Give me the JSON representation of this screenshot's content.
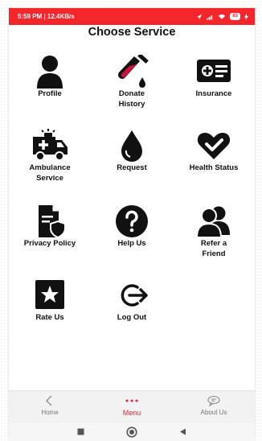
{
  "status_bar": {
    "time": "5:59 PM | 12.4KB/s",
    "battery": "83"
  },
  "header": {
    "title": "Choose Service"
  },
  "services": [
    {
      "label": "Profile",
      "icon": "person-icon"
    },
    {
      "label": "Donate\nHistory",
      "icon": "test-tube-icon"
    },
    {
      "label": "Insurance",
      "icon": "insurance-card-icon"
    },
    {
      "label": "Ambulance\nService",
      "icon": "ambulance-icon"
    },
    {
      "label": "Request",
      "icon": "blood-drop-icon"
    },
    {
      "label": "Health Status",
      "icon": "heart-check-icon"
    },
    {
      "label": "Privacy Policy",
      "icon": "shield-document-icon"
    },
    {
      "label": "Help Us",
      "icon": "question-icon"
    },
    {
      "label": "Refer a\nFriend",
      "icon": "people-icon"
    },
    {
      "label": "Rate Us",
      "icon": "star-icon"
    },
    {
      "label": "Log Out",
      "icon": "logout-icon"
    }
  ],
  "bottom_nav": {
    "items": [
      {
        "label": "Home",
        "icon": "back-chevron-icon"
      },
      {
        "label": "Menu",
        "icon": "dots-icon",
        "active": true
      },
      {
        "label": "About Us",
        "icon": "chat-bubble-icon"
      }
    ]
  },
  "colors": {
    "status_bar": "#f4252b",
    "accent": "#e3243f"
  }
}
